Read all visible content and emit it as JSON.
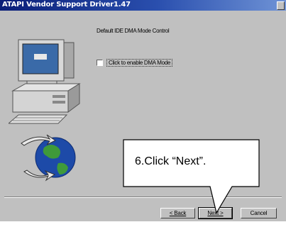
{
  "window": {
    "title": "ATAPI Vendor Support Driver1.47"
  },
  "page": {
    "heading": "Default IDE DMA Mode Control",
    "checkbox_label": "Click to enable DMA Mode",
    "checkbox_checked": false
  },
  "buttons": {
    "back_label": "< Back",
    "next_label": "Next >",
    "cancel_label": "Cancel"
  },
  "callout": {
    "text": "6.Click “Next”."
  }
}
